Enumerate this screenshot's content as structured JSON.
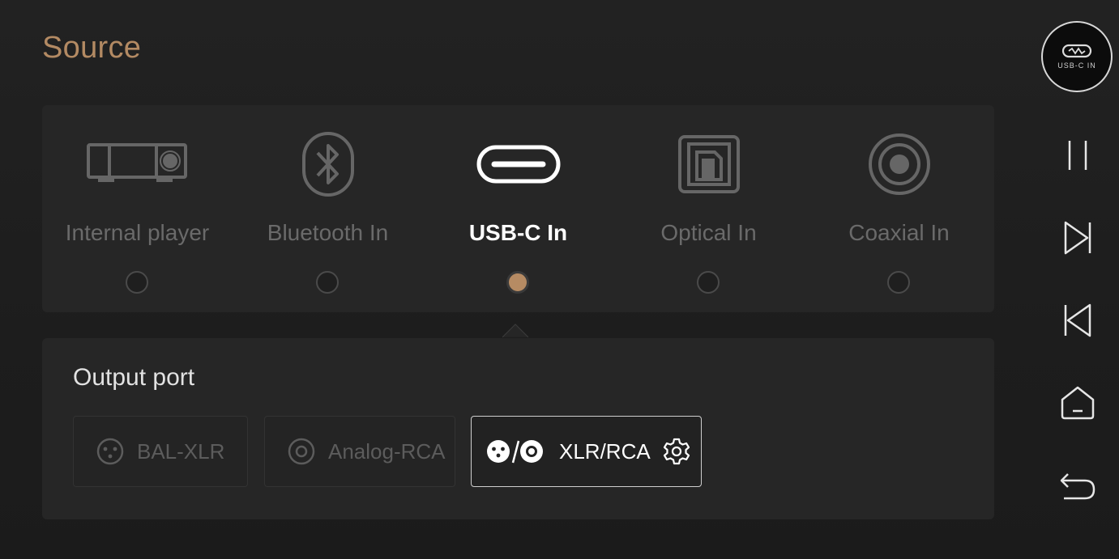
{
  "header": {
    "title": "Source"
  },
  "sources": [
    {
      "label": "Internal player",
      "icon": "player-device-icon",
      "selected": false
    },
    {
      "label": "Bluetooth In",
      "icon": "bluetooth-icon",
      "selected": false
    },
    {
      "label": "USB-C In",
      "icon": "usb-c-icon",
      "selected": true
    },
    {
      "label": "Optical In",
      "icon": "optical-icon",
      "selected": false
    },
    {
      "label": "Coaxial In",
      "icon": "coaxial-icon",
      "selected": false
    }
  ],
  "output": {
    "title": "Output port",
    "ports": [
      {
        "label": "BAL-XLR",
        "icon": "xlr-icon",
        "selected": false
      },
      {
        "label": "Analog-RCA",
        "icon": "rca-icon",
        "selected": false
      },
      {
        "label": "XLR/RCA",
        "icon": "xlr-rca-icon",
        "selected": true,
        "settings_icon": "gear-icon"
      }
    ]
  },
  "sidebar": {
    "now_source_label": "USB-C IN",
    "buttons": [
      "pause-icon",
      "next-track-icon",
      "previous-track-icon",
      "home-icon",
      "back-icon"
    ]
  },
  "colors": {
    "accent": "#b68b63",
    "background": "#1e1e1e",
    "panel": "#262626",
    "inactive_text": "#6a6a6a"
  }
}
